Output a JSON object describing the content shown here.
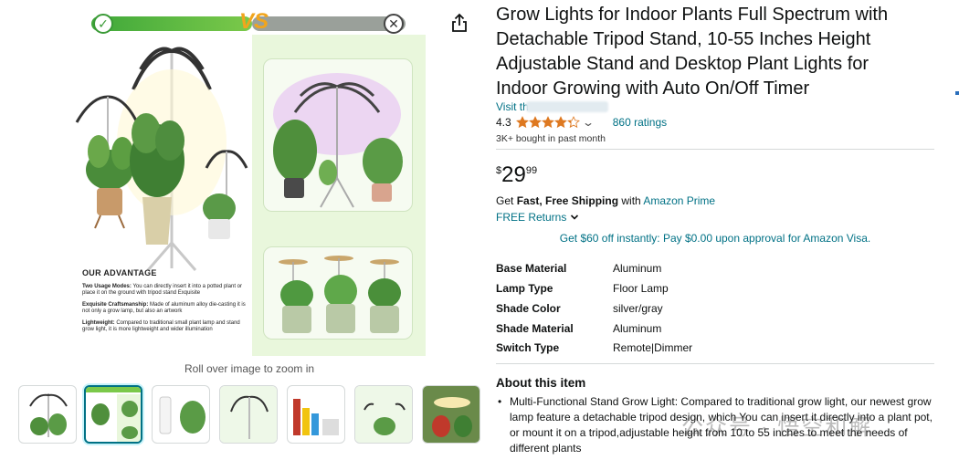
{
  "product": {
    "title": "Grow Lights for Indoor Plants Full Spectrum with Detachable Tripod Stand, 10-55 Inches Height Adjustable Stand and Desktop Plant Lights for Indoor Growing with Auto On/Off Timer",
    "visit_label": "Visit th",
    "rating": "4.3",
    "rating_fraction": 0.86,
    "rating_count": "860 ratings",
    "bought": "3K+ bought in past month",
    "price_symbol": "$",
    "price_whole": "29",
    "price_fraction": "99",
    "shipping_prefix": "Get ",
    "shipping_bold": "Fast, Free Shipping",
    "shipping_mid": " with ",
    "shipping_link": "Amazon Prime",
    "returns_label": "FREE Returns",
    "promo": "Get $60 off instantly: Pay $0.00 upon approval for Amazon Visa."
  },
  "specs": [
    {
      "key": "Base Material",
      "value": "Aluminum"
    },
    {
      "key": "Lamp Type",
      "value": "Floor Lamp"
    },
    {
      "key": "Shade Color",
      "value": "silver/gray"
    },
    {
      "key": "Shade Material",
      "value": "Aluminum"
    },
    {
      "key": "Switch Type",
      "value": "Remote|Dimmer"
    }
  ],
  "about": {
    "title": "About this item",
    "bullets": [
      "Multi-Functional Stand Grow Light: Compared to traditional grow light, our newest grow lamp feature a detachable tripod design, which You can insert it directly into a plant pot, or mount it on a tripod,adjustable height from 10 to 55 inches to meet the needs of different plants"
    ]
  },
  "gallery": {
    "zoom_hint": "Roll over image to zoom in",
    "vs_text": "VS",
    "advantage": {
      "title": "OUR ADVANTAGE",
      "items": [
        {
          "label": "Two Usage Modes:",
          "text": " You can directly insert it into a potted plant or place it on the ground with tripod stand Exquisite"
        },
        {
          "label": "Exquisite Craftsmanship:",
          "text": " Made of aluminum alloy die-casting it is not only a grow lamp, but also an artwork"
        },
        {
          "label": "Lightweight:",
          "text": " Compared to traditional small plant lamp and stand grow light, it is more lightweight and wider illumination"
        }
      ]
    },
    "thumbnail_count": 7,
    "active_thumbnail": 2
  },
  "watermark": "公众号 · 悟空和解",
  "colors": {
    "link": "#007185",
    "star": "#de7921",
    "panel_green": "#e9f7dc"
  },
  "icons": {
    "share": "share-icon",
    "star": "star-icon",
    "chevron": "chevron-down-icon"
  }
}
